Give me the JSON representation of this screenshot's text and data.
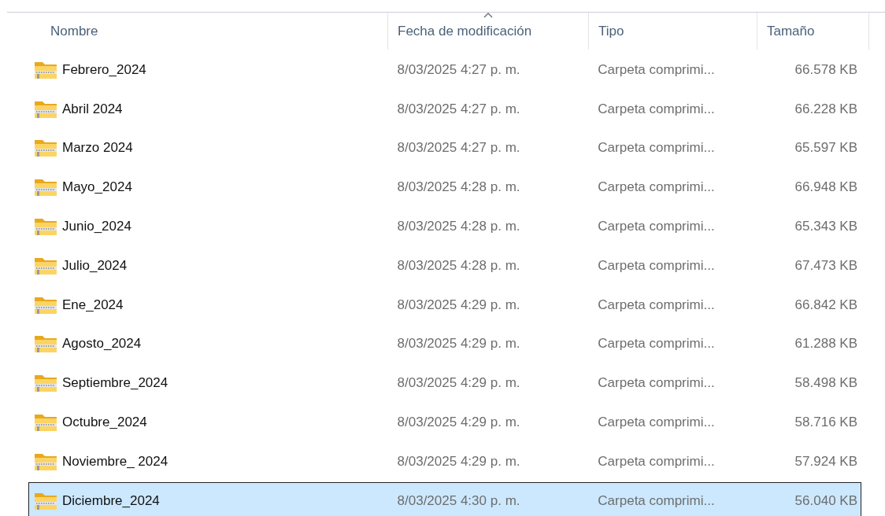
{
  "columns": [
    {
      "label": "Nombre",
      "sorted": false
    },
    {
      "label": "Fecha de modificación",
      "sorted": true
    },
    {
      "label": "Tipo",
      "sorted": false
    },
    {
      "label": "Tamaño",
      "sorted": false
    }
  ],
  "rows": [
    {
      "name": "Febrero_2024",
      "modified": "8/03/2025 4:27 p. m.",
      "type": "Carpeta comprimi...",
      "size": "66.578 KB",
      "selected": false
    },
    {
      "name": "Abril 2024",
      "modified": "8/03/2025 4:27 p. m.",
      "type": "Carpeta comprimi...",
      "size": "66.228 KB",
      "selected": false
    },
    {
      "name": "Marzo 2024",
      "modified": "8/03/2025 4:27 p. m.",
      "type": "Carpeta comprimi...",
      "size": "65.597 KB",
      "selected": false
    },
    {
      "name": "Mayo_2024",
      "modified": "8/03/2025 4:28 p. m.",
      "type": "Carpeta comprimi...",
      "size": "66.948 KB",
      "selected": false
    },
    {
      "name": "Junio_2024",
      "modified": "8/03/2025 4:28 p. m.",
      "type": "Carpeta comprimi...",
      "size": "65.343 KB",
      "selected": false
    },
    {
      "name": "Julio_2024",
      "modified": "8/03/2025 4:28 p. m.",
      "type": "Carpeta comprimi...",
      "size": "67.473 KB",
      "selected": false
    },
    {
      "name": "Ene_2024",
      "modified": "8/03/2025 4:29 p. m.",
      "type": "Carpeta comprimi...",
      "size": "66.842 KB",
      "selected": false
    },
    {
      "name": "Agosto_2024",
      "modified": "8/03/2025 4:29 p. m.",
      "type": "Carpeta comprimi...",
      "size": "61.288 KB",
      "selected": false
    },
    {
      "name": "Septiembre_2024",
      "modified": "8/03/2025 4:29 p. m.",
      "type": "Carpeta comprimi...",
      "size": "58.498 KB",
      "selected": false
    },
    {
      "name": "Octubre_2024",
      "modified": "8/03/2025 4:29 p. m.",
      "type": "Carpeta comprimi...",
      "size": "58.716 KB",
      "selected": false
    },
    {
      "name": "Noviembre_ 2024",
      "modified": "8/03/2025 4:29 p. m.",
      "type": "Carpeta comprimi...",
      "size": "57.924 KB",
      "selected": false
    },
    {
      "name": "Diciembre_2024",
      "modified": "8/03/2025 4:30 p. m.",
      "type": "Carpeta comprimi...",
      "size": "56.040 KB",
      "selected": true
    }
  ]
}
